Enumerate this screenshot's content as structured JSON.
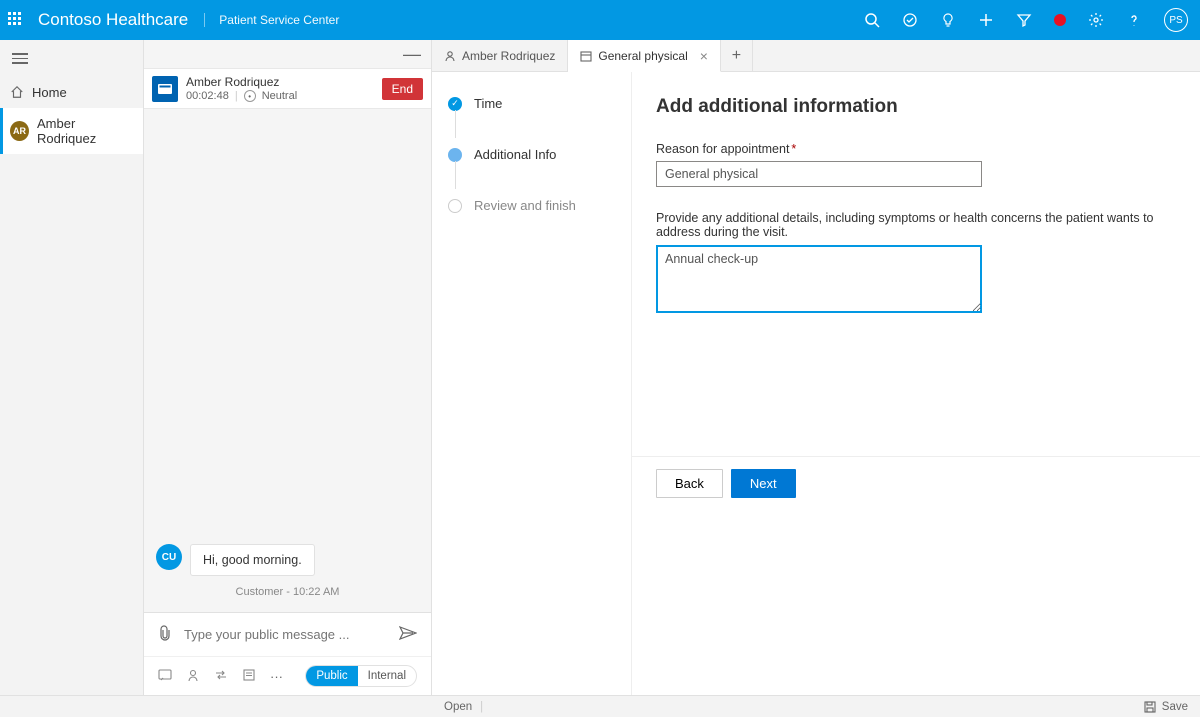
{
  "header": {
    "app_title": "Contoso Healthcare",
    "app_subtitle": "Patient Service Center",
    "user_initials": "PS"
  },
  "sidebar": {
    "home_label": "Home",
    "active_patient": "Amber Rodriquez",
    "active_initials": "AR"
  },
  "conversation": {
    "patient_name": "Amber Rodriquez",
    "timer": "00:02:48",
    "sentiment": "Neutral",
    "end_label": "End",
    "message_avatar": "CU",
    "message_text": "Hi, good morning.",
    "message_meta_role": "Customer",
    "message_meta_time": "10:22 AM",
    "compose_placeholder": "Type your public message ...",
    "mode_public": "Public",
    "mode_internal": "Internal"
  },
  "tabs": {
    "patient_tab": "Amber Rodriquez",
    "form_tab": "General physical"
  },
  "steps": {
    "time": "Time",
    "additional": "Additional Info",
    "review": "Review and finish"
  },
  "form": {
    "title": "Add additional information",
    "reason_label": "Reason for appointment",
    "reason_value": "General physical",
    "details_label": "Provide any additional details, including symptoms or health concerns the patient wants to address during the visit.",
    "details_value": "Annual check-up",
    "back_label": "Back",
    "next_label": "Next"
  },
  "statusbar": {
    "open_label": "Open",
    "save_label": "Save"
  }
}
